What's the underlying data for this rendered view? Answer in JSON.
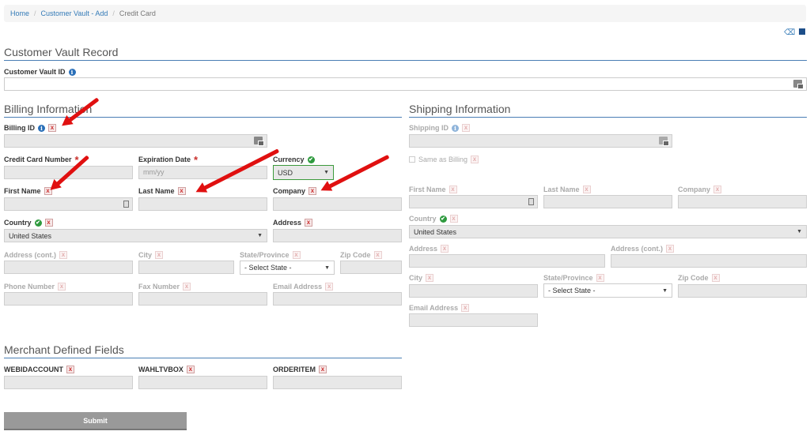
{
  "breadcrumb": {
    "home": "Home",
    "vault_add": "Customer Vault - Add",
    "current": "Credit Card",
    "separator": "/"
  },
  "toolbar": {
    "icons": [
      "eraser-icon",
      "save-icon"
    ]
  },
  "customer_vault": {
    "title": "Customer Vault Record",
    "id_label": "Customer Vault ID"
  },
  "billing": {
    "title": "Billing Information",
    "billing_id": "Billing ID",
    "credit_card_number": "Credit Card Number",
    "expiration_date": "Expiration Date",
    "expiration_placeholder": "mm/yy",
    "currency": "Currency",
    "currency_value": "USD",
    "first_name": "First Name",
    "last_name": "Last Name",
    "company": "Company",
    "country": "Country",
    "country_value": "United States",
    "address": "Address",
    "address_cont": "Address (cont.)",
    "city": "City",
    "state": "State/Province",
    "state_value": "- Select State -",
    "zip": "Zip Code",
    "phone": "Phone Number",
    "fax": "Fax Number",
    "email": "Email Address"
  },
  "shipping": {
    "title": "Shipping Information",
    "shipping_id": "Shipping ID",
    "same_as_billing": "Same as Billing",
    "first_name": "First Name",
    "last_name": "Last Name",
    "company": "Company",
    "country": "Country",
    "country_value": "United States",
    "address": "Address",
    "address_cont": "Address (cont.)",
    "city": "City",
    "state": "State/Province",
    "state_value": "- Select State -",
    "zip": "Zip Code",
    "email": "Email Address"
  },
  "merchant": {
    "title": "Merchant Defined Fields",
    "field1": "WEBIDACCOUNT",
    "field2": "WAHLTVBOX",
    "field3": "ORDERITEM"
  },
  "submit_label": "Submit",
  "glyphs": {
    "info": "i",
    "x": "x",
    "check": "✔",
    "caret": "▼",
    "required": "*"
  },
  "colors": {
    "link": "#337ab7",
    "section_rule": "#4a7eb4",
    "required": "#c9302c",
    "valid": "#2e9a3e",
    "annotation_arrow": "#e01010"
  }
}
